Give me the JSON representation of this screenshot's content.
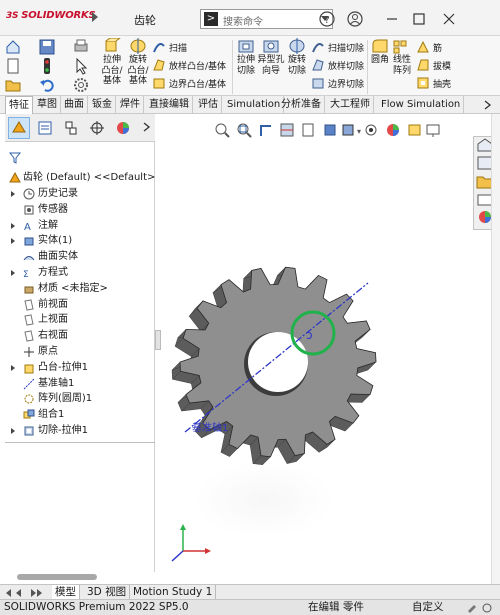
{
  "app": {
    "logo": "SOLIDWORKS",
    "doc_title": "齿轮"
  },
  "search": {
    "placeholder": "搜索命令",
    "prompt_glyph": ">"
  },
  "title_buttons": [
    "help-icon",
    "user-icon",
    "minimize-icon",
    "maximize-icon",
    "close-icon"
  ],
  "ribbon": {
    "extrude_boss": "拉伸\n凸台/\n基体",
    "revolve_boss": "旋转\n凸台/\n基体",
    "sweep": "扫描",
    "loft_boss": "放样凸台/基体",
    "boundary_boss": "边界凸台/基体",
    "extrude_cut": "拉伸\n切除",
    "hole_wizard": "异型孔\n向导",
    "revolve_cut": "旋转\n切除",
    "swept_cut": "扫描切除",
    "lofted_cut": "放样切除",
    "boundary_cut": "边界切除",
    "fillet": "圆角",
    "linear_pattern": "线性\n阵列",
    "rib": "筋",
    "draft": "拔模",
    "shell": "抽壳"
  },
  "tabs": [
    "特征",
    "草图",
    "曲面",
    "钣金",
    "焊件",
    "直接编辑",
    "评估",
    "Simulation",
    "分析准备",
    "大工程师",
    "Flow Simulation"
  ],
  "tree": {
    "root": "齿轮 (Default) <<Default>_Ph",
    "items": [
      {
        "label": "历史记录",
        "icon": "history-icon",
        "arrow": true
      },
      {
        "label": "传感器",
        "icon": "sensor-icon",
        "arrow": false
      },
      {
        "label": "注解",
        "icon": "annotation-icon",
        "arrow": true
      },
      {
        "label": "实体(1)",
        "icon": "solid-bodies-icon",
        "arrow": true
      },
      {
        "label": "曲面实体",
        "icon": "surface-bodies-icon",
        "arrow": false
      },
      {
        "label": "方程式",
        "icon": "equations-icon",
        "arrow": true
      },
      {
        "label": "材质 <未指定>",
        "icon": "material-icon",
        "arrow": false
      },
      {
        "label": "前视面",
        "icon": "plane-icon",
        "arrow": false
      },
      {
        "label": "上视面",
        "icon": "plane-icon",
        "arrow": false
      },
      {
        "label": "右视面",
        "icon": "plane-icon",
        "arrow": false
      },
      {
        "label": "原点",
        "icon": "origin-icon",
        "arrow": false
      },
      {
        "label": "凸台-拉伸1",
        "icon": "extrude-icon",
        "arrow": true
      },
      {
        "label": "基准轴1",
        "icon": "axis-icon",
        "arrow": false
      },
      {
        "label": "阵列(圆周)1",
        "icon": "circular-pattern-icon",
        "arrow": false
      },
      {
        "label": "组合1",
        "icon": "combine-icon",
        "arrow": false
      },
      {
        "label": "切除-拉伸1",
        "icon": "cut-extrude-icon",
        "arrow": true
      }
    ]
  },
  "viewport": {
    "axis_label": "基准轴1"
  },
  "bottom_tabs": [
    "模型",
    "3D 视图",
    "Motion Study 1"
  ],
  "status": {
    "product": "SOLIDWORKS Premium 2022 SP5.0",
    "mode": "在编辑 零件",
    "units": "自定义"
  },
  "colors": {
    "accent_blue": "#1f5fbf",
    "sw_red": "#c8102e",
    "axis_blue": "#2d36c9",
    "highlight_green": "#22b24c",
    "gear_face": "#8f8f8f"
  }
}
